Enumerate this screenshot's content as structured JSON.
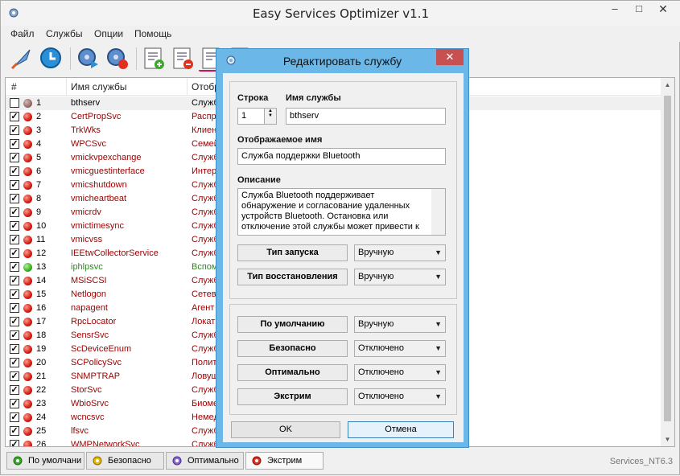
{
  "window": {
    "title": "Easy Services Optimizer v1.1"
  },
  "menu": [
    "Файл",
    "Службы",
    "Опции",
    "Помощь"
  ],
  "toolbar_icons": [
    "rocket-icon",
    "restore-icon",
    "gear-play-icon",
    "gear-stop-icon",
    "list-add-icon",
    "list-remove-icon",
    "list-edit-icon",
    "list-icon"
  ],
  "table": {
    "headers": {
      "num": "#",
      "name": "Имя службы",
      "display": "Отобр"
    },
    "rows": [
      {
        "n": "1",
        "name": "bthserv",
        "display": "Служб",
        "checked": false,
        "status": "gray",
        "sel": true
      },
      {
        "n": "2",
        "name": "CertPropSvc",
        "display": "Распре",
        "checked": true,
        "status": "red"
      },
      {
        "n": "3",
        "name": "TrkWks",
        "display": "Клиен",
        "checked": true,
        "status": "red"
      },
      {
        "n": "4",
        "name": "WPCSvc",
        "display": "Семей",
        "checked": true,
        "status": "red"
      },
      {
        "n": "5",
        "name": "vmickvpexchange",
        "display": "Служб",
        "checked": true,
        "status": "red"
      },
      {
        "n": "6",
        "name": "vmicguestinterface",
        "display": "Интер",
        "checked": true,
        "status": "red"
      },
      {
        "n": "7",
        "name": "vmicshutdown",
        "display": "Служб",
        "checked": true,
        "status": "red"
      },
      {
        "n": "8",
        "name": "vmicheartbeat",
        "display": "Служб",
        "checked": true,
        "status": "red"
      },
      {
        "n": "9",
        "name": "vmicrdv",
        "display": "Служб",
        "checked": true,
        "status": "red"
      },
      {
        "n": "10",
        "name": "vmictimesync",
        "display": "Служб",
        "checked": true,
        "status": "red"
      },
      {
        "n": "11",
        "name": "vmicvss",
        "display": "Служб",
        "checked": true,
        "status": "red"
      },
      {
        "n": "12",
        "name": "IEEtwCollectorService",
        "display": "Служб",
        "checked": true,
        "status": "red"
      },
      {
        "n": "13",
        "name": "iphlpsvc",
        "display": "Вспом",
        "checked": true,
        "status": "green"
      },
      {
        "n": "14",
        "name": "MSiSCSI",
        "display": "Служб",
        "checked": true,
        "status": "red"
      },
      {
        "n": "15",
        "name": "Netlogon",
        "display": "Сетев",
        "checked": true,
        "status": "red"
      },
      {
        "n": "16",
        "name": "napagent",
        "display": "Агент",
        "checked": true,
        "status": "red"
      },
      {
        "n": "17",
        "name": "RpcLocator",
        "display": "Локат",
        "checked": true,
        "status": "red"
      },
      {
        "n": "18",
        "name": "SensrSvc",
        "display": "Служб",
        "checked": true,
        "status": "red"
      },
      {
        "n": "19",
        "name": "ScDeviceEnum",
        "display": "Служб",
        "checked": true,
        "status": "red"
      },
      {
        "n": "20",
        "name": "SCPolicySvc",
        "display": "Полит",
        "checked": true,
        "status": "red"
      },
      {
        "n": "21",
        "name": "SNMPTRAP",
        "display": "Ловуш",
        "checked": true,
        "status": "red"
      },
      {
        "n": "22",
        "name": "StorSvc",
        "display": "Служб",
        "checked": true,
        "status": "red"
      },
      {
        "n": "23",
        "name": "WbioSrvc",
        "display": "Биоме",
        "checked": true,
        "status": "red"
      },
      {
        "n": "24",
        "name": "wcncsvc",
        "display": "Немед",
        "checked": true,
        "status": "red"
      },
      {
        "n": "25",
        "name": "lfsvc",
        "display": "Служб",
        "checked": true,
        "status": "red"
      },
      {
        "n": "26",
        "name": "WMPNetworkSvc",
        "display": "Служб",
        "checked": true,
        "status": "red"
      }
    ]
  },
  "status_buttons": [
    "По умолчани",
    "Безопасно",
    "Оптимально",
    "Экстрим"
  ],
  "status_label": "Services_NT6.3",
  "dialog": {
    "title": "Редактировать службу",
    "close": "✕",
    "row_label": "Строка",
    "row_value": "1",
    "name_label": "Имя службы",
    "name_value": "bthserv",
    "display_label": "Отображаемое имя",
    "display_value": "Служба поддержки Bluetooth",
    "desc_label": "Описание",
    "desc_lines": [
      "Служба Bluetooth поддерживает",
      "обнаружение и согласование удаленных",
      "устройств Bluetooth. Остановка или",
      "отключение этой службы может привести к"
    ],
    "startup_label": "Тип запуска",
    "startup_value": "Вручную",
    "recovery_label": "Тип восстановления",
    "recovery_value": "Вручную",
    "default_label": "По умолчанию",
    "default_value": "Вручную",
    "safe_label": "Безопасно",
    "safe_value": "Отключено",
    "optimal_label": "Оптимально",
    "optimal_value": "Отключено",
    "extreme_label": "Экстрим",
    "extreme_value": "Отключено",
    "ok": "OK",
    "cancel": "Отмена"
  }
}
